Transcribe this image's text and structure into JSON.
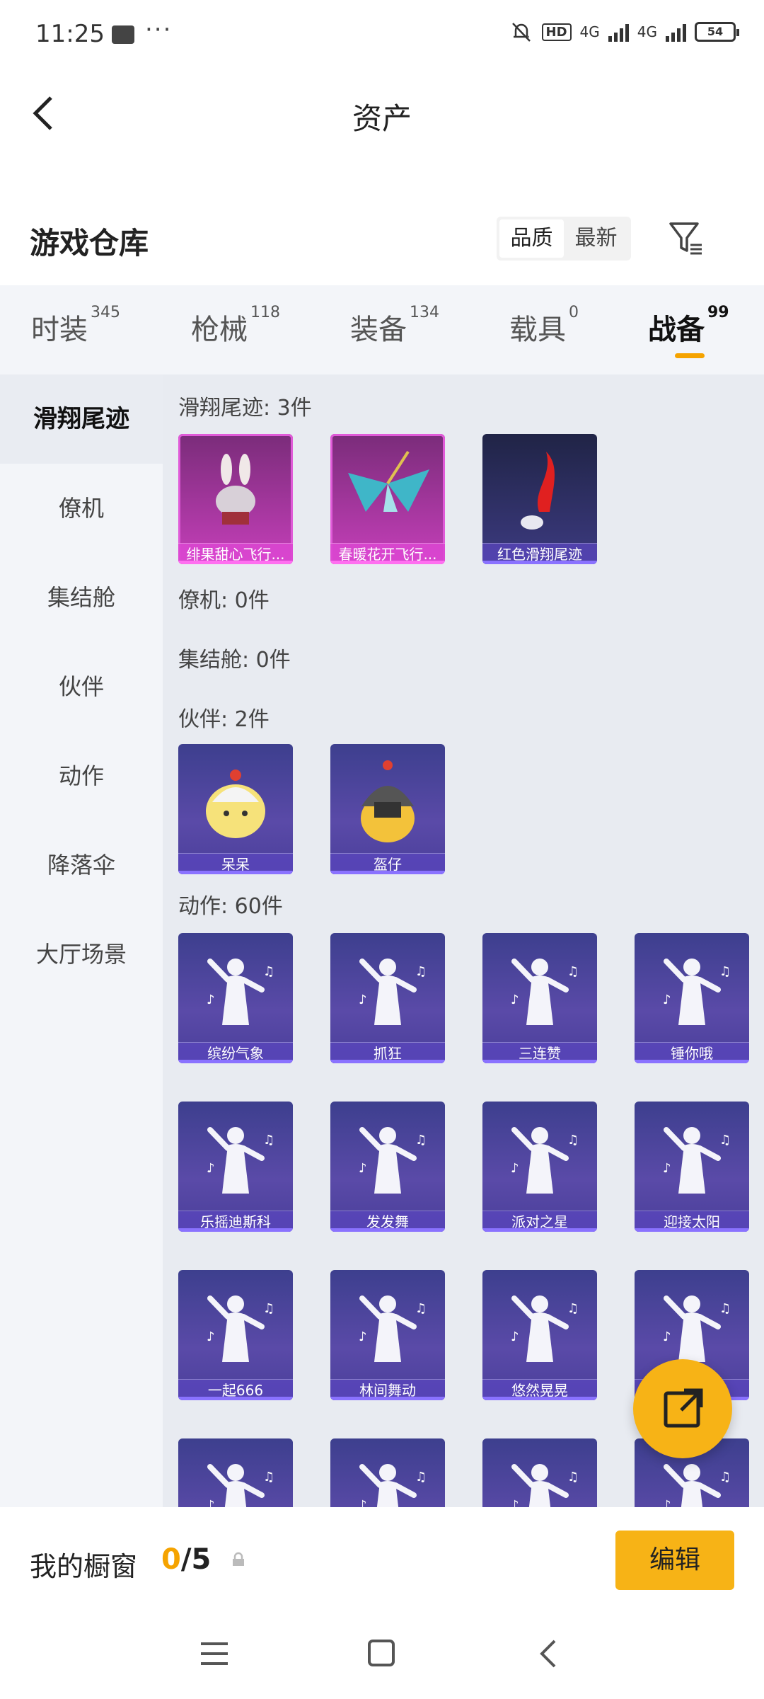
{
  "status_bar": {
    "time": "11:25",
    "battery": "54",
    "network": "4G"
  },
  "header": {
    "title": "资产"
  },
  "warehouse": {
    "title": "游戏仓库",
    "sort_quality": "品质",
    "sort_latest": "最新"
  },
  "tabs": [
    {
      "label": "时装",
      "count": "345"
    },
    {
      "label": "枪械",
      "count": "118"
    },
    {
      "label": "装备",
      "count": "134"
    },
    {
      "label": "载具",
      "count": "0"
    },
    {
      "label": "战备",
      "count": "99"
    }
  ],
  "sidebar": [
    "滑翔尾迹",
    "僚机",
    "集结舱",
    "伙伴",
    "动作",
    "降落伞",
    "大厅场景"
  ],
  "sections": {
    "glide": "滑翔尾迹: 3件",
    "wingman": "僚机: 0件",
    "pod": "集结舱: 0件",
    "partner": "伙伴: 2件",
    "emote": "动作: 60件"
  },
  "glide_items": [
    "绯果甜心飞行...",
    "春暖花开飞行...",
    "红色滑翔尾迹"
  ],
  "partner_items": [
    "呆呆",
    "盔仔"
  ],
  "emote_items": [
    "缤纷气象",
    "抓狂",
    "三连赞",
    "锤你哦",
    "乐摇迪斯科",
    "发发舞",
    "派对之星",
    "迎接太阳",
    "一起666",
    "林间舞动",
    "悠然晃晃",
    ""
  ],
  "bottom": {
    "showcase_label": "我的橱窗",
    "count_current": "0",
    "count_total": "/5",
    "edit_label": "编辑"
  },
  "colors": {
    "accent": "#f7b316",
    "tab_underline": "#f5a300"
  }
}
